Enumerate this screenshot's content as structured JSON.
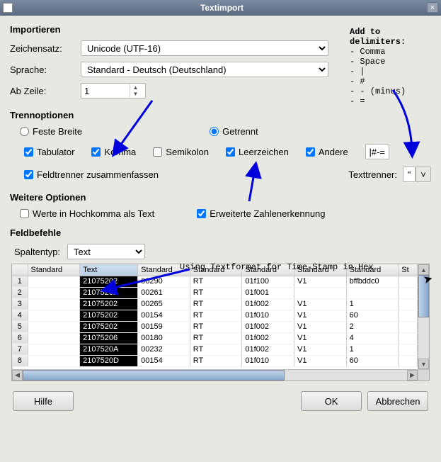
{
  "window": {
    "title": "Textimport"
  },
  "import": {
    "header": "Importieren",
    "charset_label": "Zeichensatz:",
    "charset_value": "Unicode (UTF-16)",
    "language_label": "Sprache:",
    "language_value": "Standard - Deutsch (Deutschland)",
    "fromrow_label": "Ab Zeile:",
    "fromrow_value": "1"
  },
  "separator": {
    "header": "Trennoptionen",
    "fixed_label": "Feste Breite",
    "separated_label": "Getrennt",
    "tab_label": "Tabulator",
    "comma_label": "Komma",
    "semicolon_label": "Semikolon",
    "space_label": "Leerzeichen",
    "other_label": "Andere",
    "other_value": "|#-=",
    "merge_label": "Feldtrenner zusammenfassen",
    "textdelim_label": "Texttrenner:",
    "textdelim_value": "\""
  },
  "more": {
    "header": "Weitere Optionen",
    "quoted_label": "Werte in Hochkomma als Text",
    "numbers_label": "Erweiterte Zahlenerkennung"
  },
  "fields": {
    "header": "Feldbefehle",
    "coltype_label": "Spaltentyp:",
    "coltype_value": "Text"
  },
  "preview": {
    "headers": [
      "Standard",
      "Text",
      "Standard",
      "Standard",
      "Standard",
      "Standard",
      "Standard",
      "St"
    ],
    "rows": [
      [
        "",
        "21075202",
        "00290",
        "RT",
        "01f100",
        "V1",
        "bffbddc0",
        ""
      ],
      [
        "",
        "21075202",
        "00261",
        "RT",
        "01f001",
        "",
        "",
        ""
      ],
      [
        "",
        "21075202",
        "00265",
        "RT",
        "01f002",
        "V1",
        "1",
        ""
      ],
      [
        "",
        "21075202",
        "00154",
        "RT",
        "01f010",
        "V1",
        "60",
        ""
      ],
      [
        "",
        "21075202",
        "00159",
        "RT",
        "01f002",
        "V1",
        "2",
        ""
      ],
      [
        "",
        "21075206",
        "00180",
        "RT",
        "01f002",
        "V1",
        "4",
        ""
      ],
      [
        "",
        "2107520A",
        "00232",
        "RT",
        "01f002",
        "V1",
        "1",
        ""
      ],
      [
        "",
        "2107520D",
        "00154",
        "RT",
        "01f010",
        "V1",
        "60",
        ""
      ]
    ]
  },
  "buttons": {
    "help": "Hilfe",
    "ok": "OK",
    "cancel": "Abbrechen"
  },
  "annotations": {
    "delim_title": "Add to delimiters:",
    "delim_lines": [
      "- Comma",
      "- Space",
      "- |",
      "- #",
      "- - (minus)",
      "- ="
    ],
    "textformat_note": "Using Textformat for Time-Stamp in Hex"
  }
}
